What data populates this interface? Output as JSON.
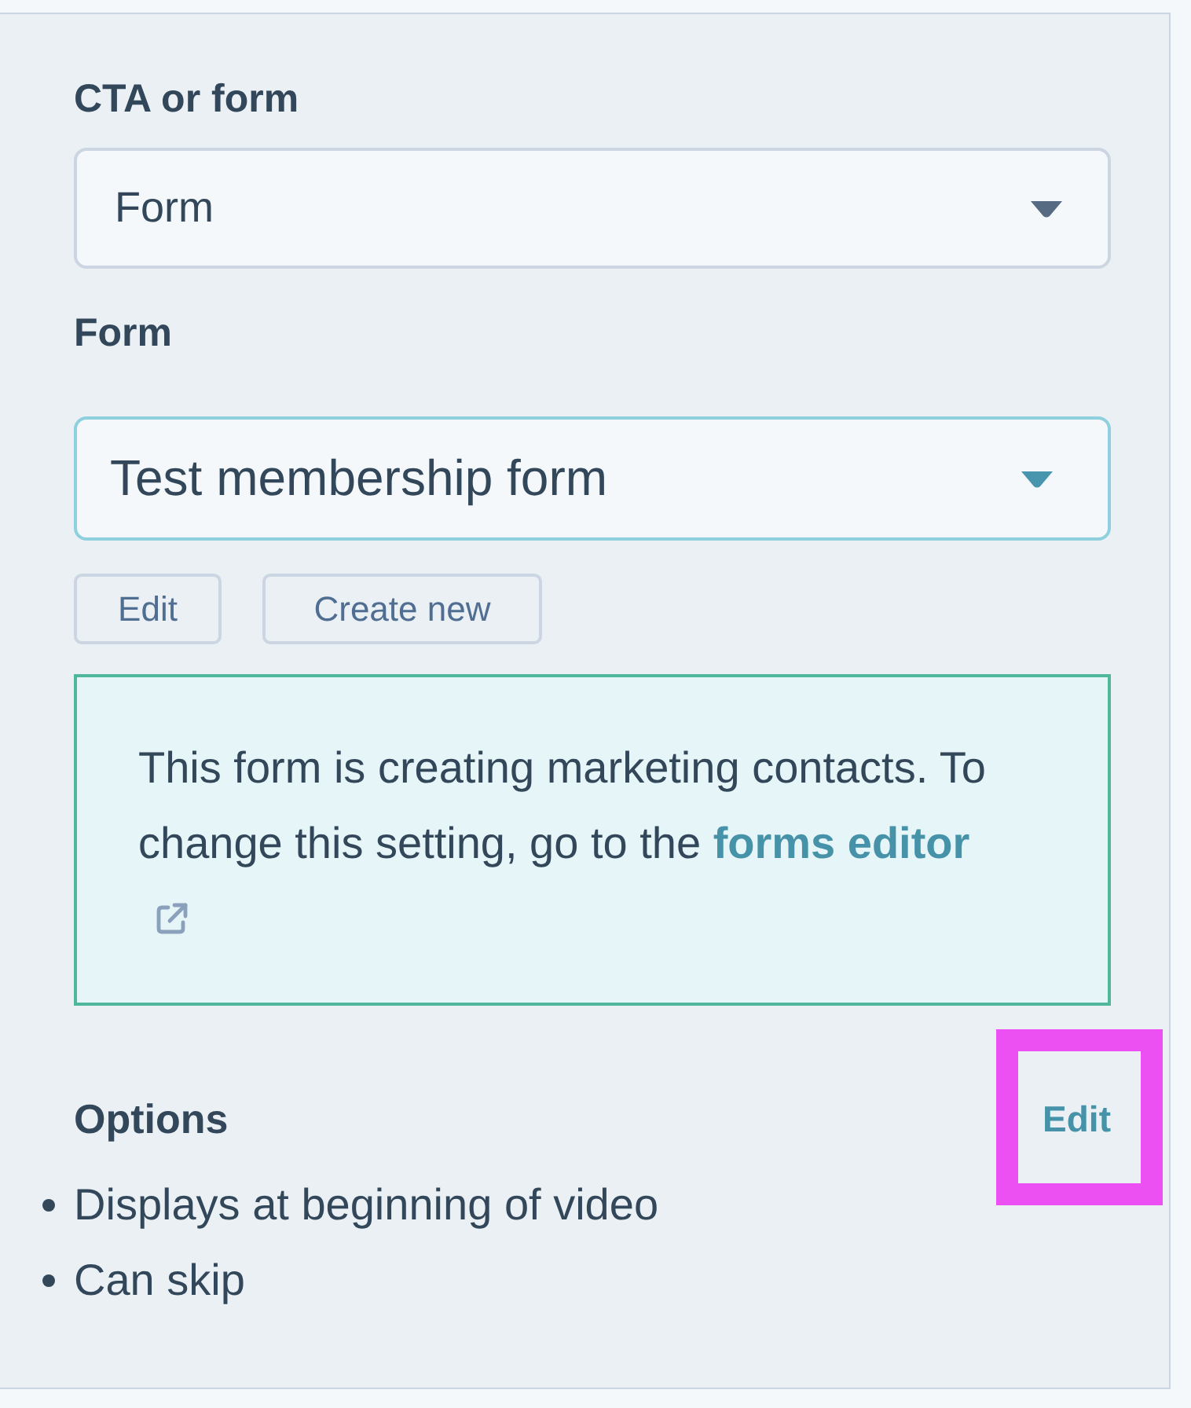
{
  "fields": [
    {
      "label": "CTA or form",
      "value": "Form",
      "focused": false
    },
    {
      "label": "Form",
      "value": "Test membership form",
      "focused": true
    }
  ],
  "form_actions": [
    "Edit",
    "Create new"
  ],
  "notice": {
    "text": "This form is creating marketing contacts. To change this setting, go to the",
    "link": "forms editor"
  },
  "options": {
    "title": "Options",
    "edit_link": {
      "label": "Edit",
      "highlighted": true
    },
    "items": [
      "Displays at beginning of video",
      "Can skip"
    ]
  }
}
